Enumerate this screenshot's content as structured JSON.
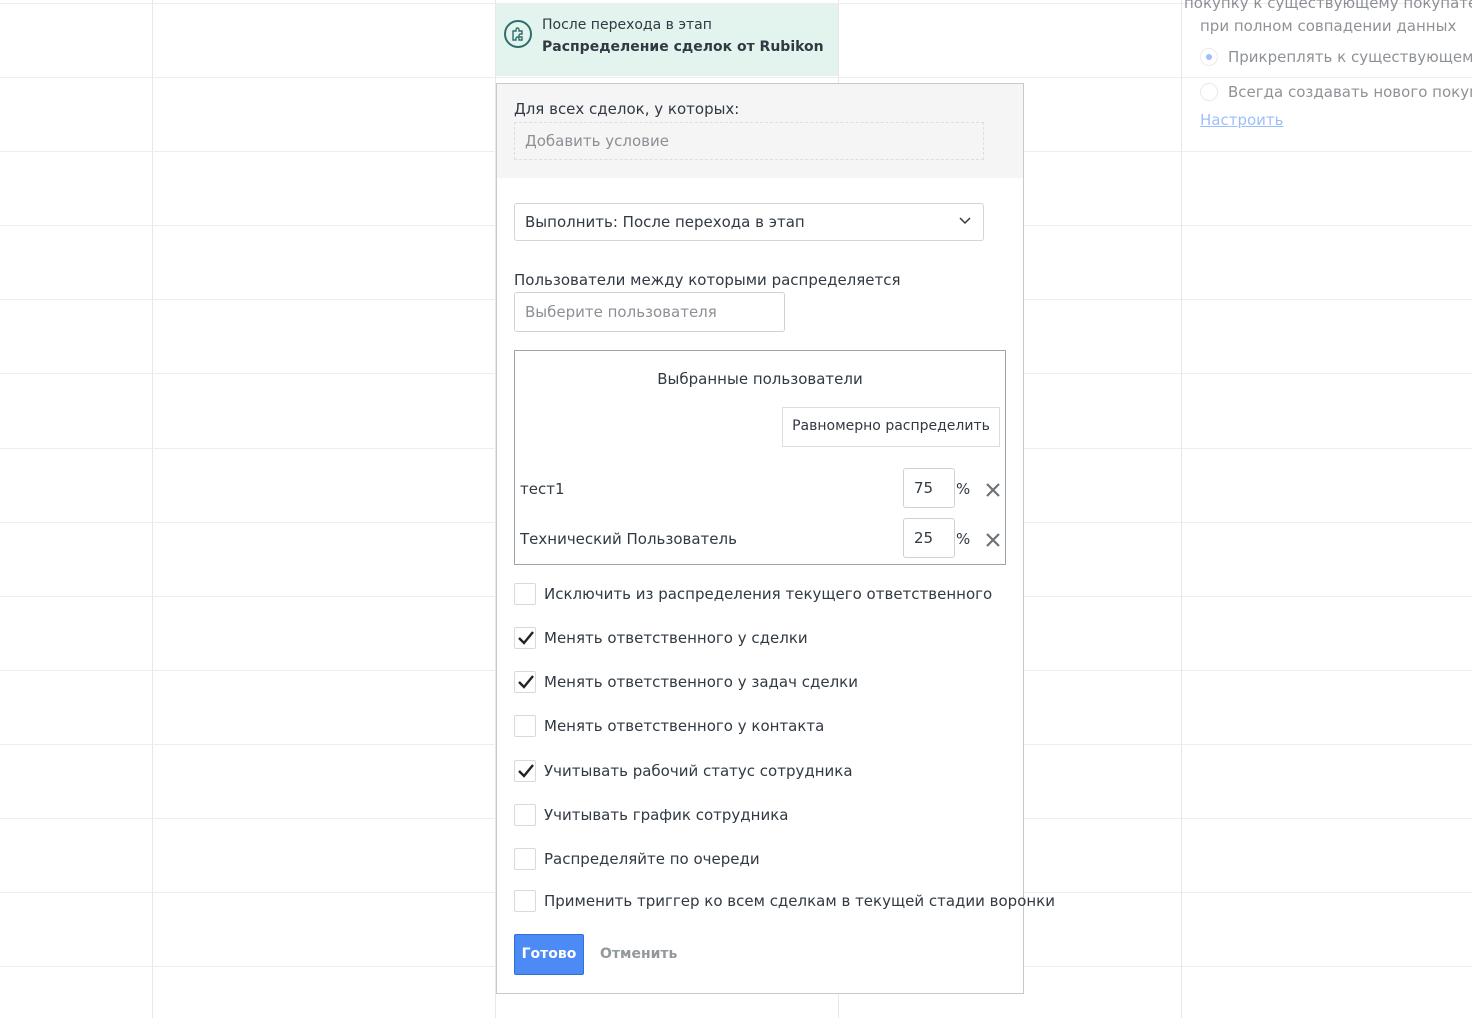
{
  "trigger": {
    "title": "После перехода в этап",
    "name": "Распределение сделок от Rubikon"
  },
  "right_panel": {
    "line1": "покупку к существующему покупател",
    "line2": "при полном совпадении данных",
    "option1": "Прикреплять к существующему",
    "option2": "Всегда создавать нового покупате",
    "link": "Настроить"
  },
  "modal": {
    "conditions_label": "Для всех сделок, у которых:",
    "add_condition": "Добавить условие",
    "execute_select": "Выполнить: После перехода в этап",
    "users_label": "Пользователи между которыми распределяется",
    "user_input_placeholder": "Выберите пользователя",
    "selected_title": "Выбранные пользователи",
    "even_button": "Равномерно распределить",
    "users": [
      {
        "name": "тест1",
        "percent": "75"
      },
      {
        "name": "Технический Пользователь",
        "percent": "25"
      }
    ],
    "percent_sign": "%",
    "checkboxes": [
      {
        "label": "Исключить из распределения текущего ответственного",
        "checked": false
      },
      {
        "label": "Менять ответственного у сделки",
        "checked": true
      },
      {
        "label": "Менять ответственного у задач сделки",
        "checked": true
      },
      {
        "label": "Менять ответственного у контакта",
        "checked": false
      },
      {
        "label": "Учитывать рабочий статус сотрудника",
        "checked": true
      },
      {
        "label": "Учитывать график сотрудника",
        "checked": false
      },
      {
        "label": "Распределяйте по очереди",
        "checked": false
      },
      {
        "label": "Применить триггер ко всем сделкам в текущей стадии воронки",
        "checked": false
      }
    ],
    "done_button": "Готово",
    "cancel_button": "Отменить"
  },
  "colors": {
    "accent": "#4c8bf5",
    "trigger_bg": "#e3f3ee",
    "text": "#313942"
  },
  "icons": [
    "puzzle-icon",
    "chevron-down-icon",
    "close-icon",
    "checkmark-icon"
  ]
}
